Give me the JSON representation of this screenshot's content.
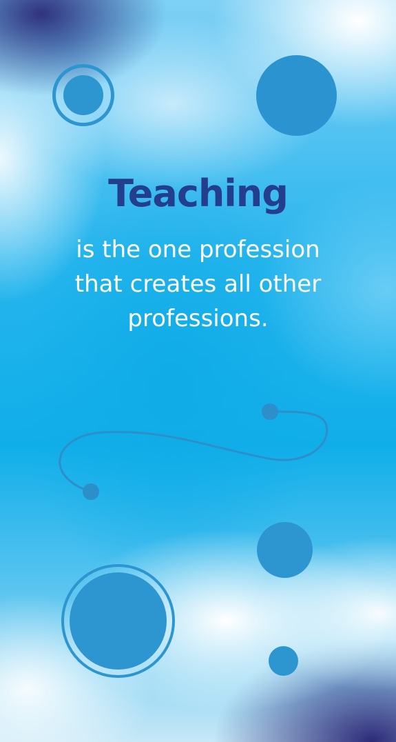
{
  "quote": {
    "headline": "Teaching",
    "lines": [
      "is the one profession",
      "that creates all other",
      "professions."
    ]
  },
  "colors": {
    "headline": "#243e8e",
    "body_text": "#ffffff",
    "decor": "#2d96d1",
    "background_primary": "#17b4ee",
    "background_dark": "#2c2a78"
  }
}
